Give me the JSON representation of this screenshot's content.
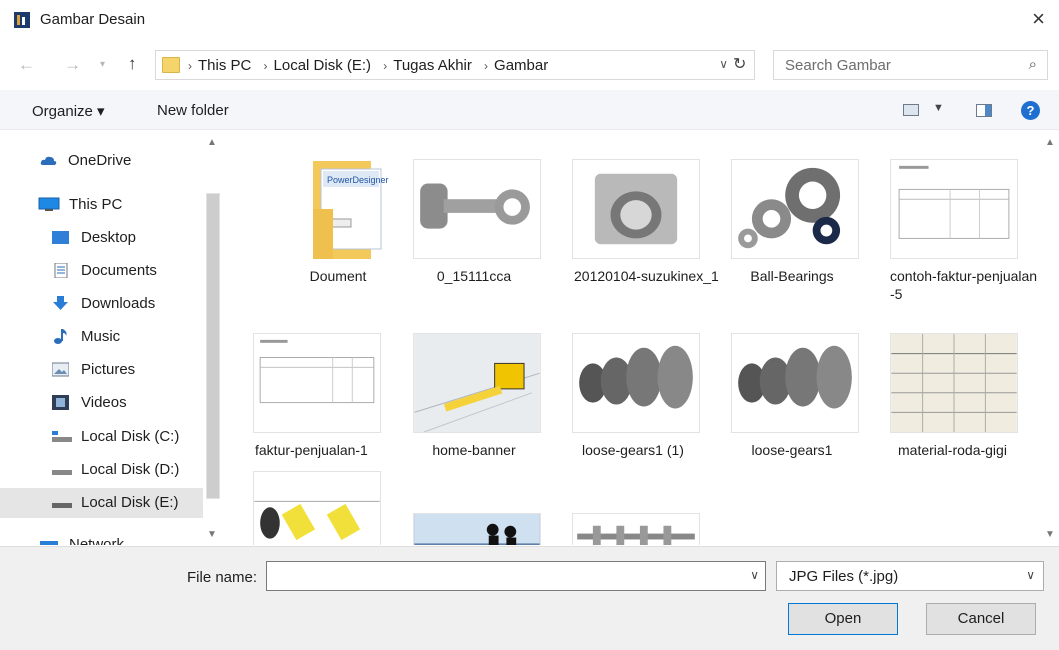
{
  "window": {
    "title": "Gambar Desain",
    "close_icon": "close-icon"
  },
  "nav": {
    "back_icon": "back-arrow-icon",
    "forward_icon": "forward-arrow-icon",
    "up_icon": "up-arrow-icon",
    "breadcrumb": [
      "This PC",
      "Local Disk (E:)",
      "Tugas Akhir",
      "Gambar"
    ],
    "separator": "›",
    "search_placeholder": "Search Gambar"
  },
  "toolbar": {
    "organize_label": "Organize ▾",
    "new_folder_label": "New folder",
    "help": "?"
  },
  "sidebar": {
    "items": [
      {
        "label": "OneDrive",
        "icon": "cloud-icon",
        "selected": false
      },
      {
        "label": "This PC",
        "icon": "computer-icon",
        "selected": false
      },
      {
        "label": "Desktop",
        "icon": "desktop-icon",
        "selected": false
      },
      {
        "label": "Documents",
        "icon": "documents-icon",
        "selected": false
      },
      {
        "label": "Downloads",
        "icon": "downloads-icon",
        "selected": false
      },
      {
        "label": "Music",
        "icon": "music-icon",
        "selected": false
      },
      {
        "label": "Pictures",
        "icon": "pictures-icon",
        "selected": false
      },
      {
        "label": "Videos",
        "icon": "videos-icon",
        "selected": false
      },
      {
        "label": "Local Disk (C:)",
        "icon": "drive-icon",
        "selected": false
      },
      {
        "label": "Local Disk (D:)",
        "icon": "drive-icon",
        "selected": false
      },
      {
        "label": "Local Disk (E:)",
        "icon": "drive-icon",
        "selected": true
      },
      {
        "label": "Network",
        "icon": "network-icon",
        "selected": false
      }
    ]
  },
  "files": [
    {
      "name": "Doument"
    },
    {
      "name": "0_15111cca"
    },
    {
      "name": "20120104-suzukinex_1"
    },
    {
      "name": "Ball-Bearings"
    },
    {
      "name": "contoh-faktur-penjualan-5"
    },
    {
      "name": "faktur-penjualan-1"
    },
    {
      "name": "home-banner"
    },
    {
      "name": "loose-gears1 (1)"
    },
    {
      "name": "loose-gears1"
    },
    {
      "name": "material-roda-gigi"
    },
    {
      "name": ""
    },
    {
      "name": ""
    },
    {
      "name": ""
    }
  ],
  "footer": {
    "file_name_label": "File name:",
    "file_name_value": "",
    "file_type": "JPG Files (*.jpg)",
    "open_label": "Open",
    "cancel_label": "Cancel"
  }
}
